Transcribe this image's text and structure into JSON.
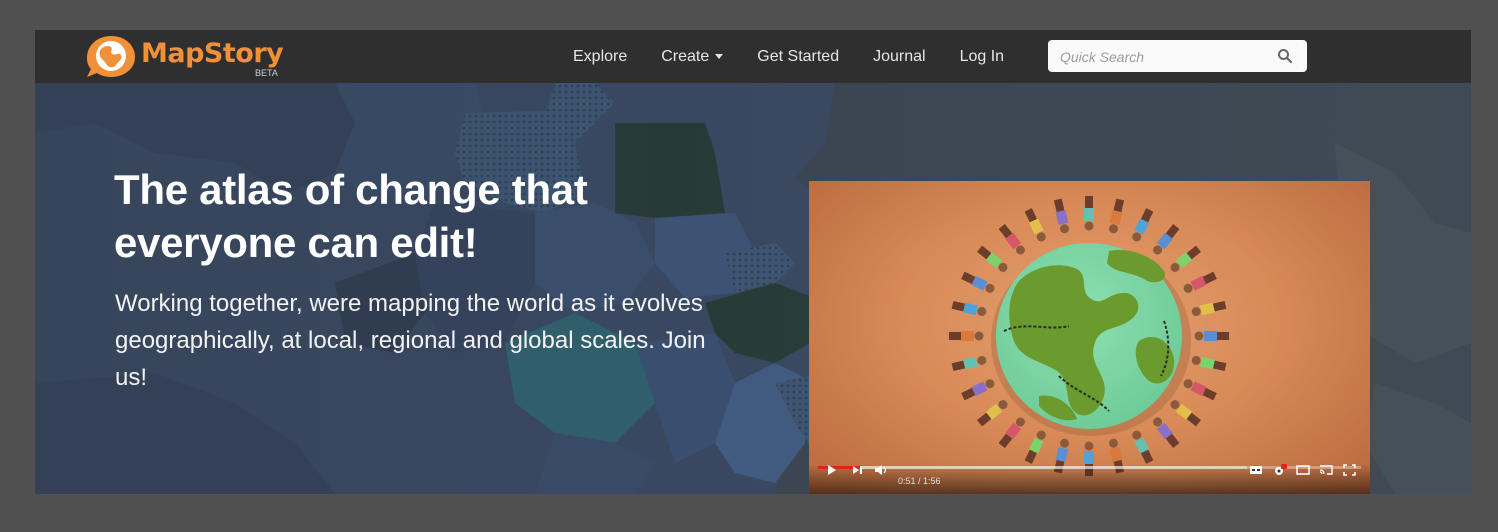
{
  "brand": {
    "name": "MapStory",
    "badge": "BETA",
    "color": "#f0913a"
  },
  "nav": {
    "items": [
      {
        "label": "Explore"
      },
      {
        "label": "Create",
        "dropdown": true
      },
      {
        "label": "Get Started"
      },
      {
        "label": "Journal"
      },
      {
        "label": "Log In"
      }
    ]
  },
  "search": {
    "placeholder": "Quick Search",
    "icon": "search-icon"
  },
  "hero": {
    "headline": "The atlas of change that everyone can edit!",
    "subtext": "Working together, were mapping the world as it evolves geographically, at local, regional and global scales. Join us!"
  },
  "video": {
    "time": "0:51 / 1:56",
    "progress": 0.078,
    "buffered": 0.79,
    "icons": [
      "play-icon",
      "next-icon",
      "volume-icon",
      "captions-icon",
      "settings-icon",
      "theater-icon",
      "cast-icon",
      "fullscreen-icon"
    ]
  }
}
